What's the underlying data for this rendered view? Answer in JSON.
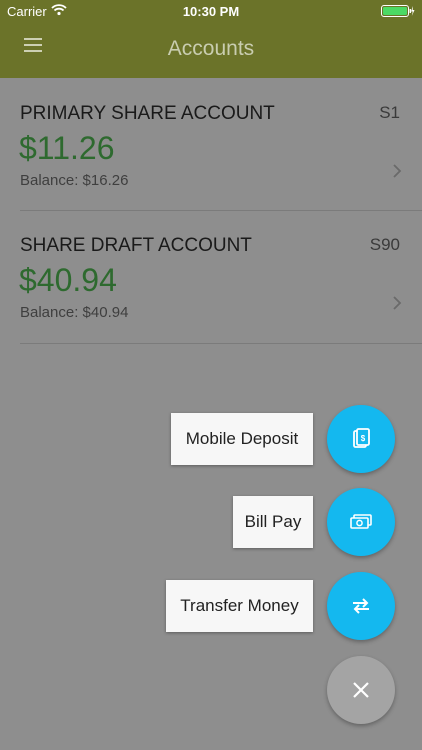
{
  "status_bar": {
    "carrier": "Carrier",
    "time": "10:30 PM"
  },
  "nav": {
    "title": "Accounts"
  },
  "accounts": [
    {
      "name": "PRIMARY SHARE ACCOUNT",
      "code": "S1",
      "available": "$11.26",
      "balance": "Balance: $16.26"
    },
    {
      "name": "SHARE DRAFT ACCOUNT",
      "code": "S90",
      "available": "$40.94",
      "balance": "Balance: $40.94"
    }
  ],
  "actions": {
    "mobile_deposit": "Mobile Deposit",
    "bill_pay": "Bill Pay",
    "transfer_money": "Transfer Money"
  },
  "colors": {
    "header": "#6b7329",
    "amount": "#2e6a2f",
    "fab": "#14b8ef",
    "fab_close": "#a4a4a4",
    "overlay": "#8e8e8e"
  },
  "icons": [
    "wifi-icon",
    "battery-icon",
    "menu-icon",
    "chevron-right-icon",
    "mobile-deposit-icon",
    "bill-pay-icon",
    "transfer-icon",
    "close-icon"
  ]
}
